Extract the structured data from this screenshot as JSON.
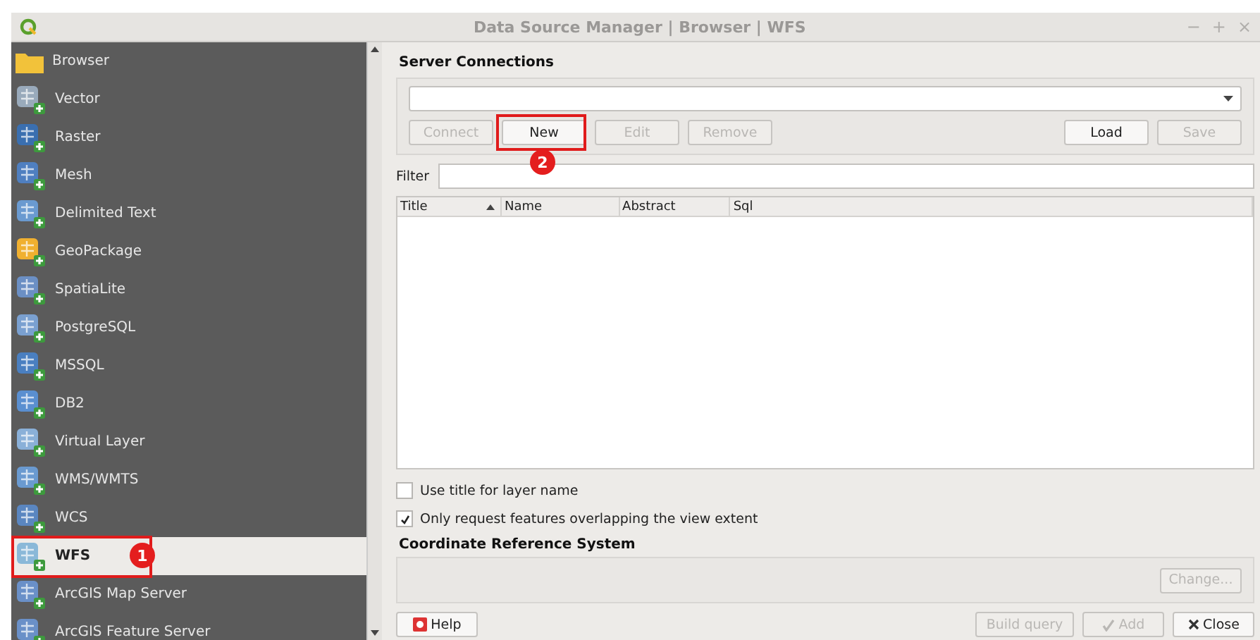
{
  "window": {
    "title": "Data Source Manager | Browser | WFS",
    "controls": [
      "−",
      "+",
      "×"
    ]
  },
  "sidebar": {
    "items": [
      {
        "label": "Browser",
        "selected": false
      },
      {
        "label": "Vector",
        "selected": false
      },
      {
        "label": "Raster",
        "selected": false
      },
      {
        "label": "Mesh",
        "selected": false
      },
      {
        "label": "Delimited Text",
        "selected": false
      },
      {
        "label": "GeoPackage",
        "selected": false
      },
      {
        "label": "SpatiaLite",
        "selected": false
      },
      {
        "label": "PostgreSQL",
        "selected": false
      },
      {
        "label": "MSSQL",
        "selected": false
      },
      {
        "label": "DB2",
        "selected": false
      },
      {
        "label": "Virtual Layer",
        "selected": false
      },
      {
        "label": "WMS/WMTS",
        "selected": false
      },
      {
        "label": "WCS",
        "selected": false
      },
      {
        "label": "WFS",
        "selected": true,
        "annotation": "1"
      },
      {
        "label": "ArcGIS Map Server",
        "selected": false
      },
      {
        "label": "ArcGIS Feature Server",
        "selected": false
      }
    ]
  },
  "server_connections": {
    "title": "Server Connections",
    "buttons": [
      {
        "label": "Connect",
        "disabled": true
      },
      {
        "label": "New",
        "disabled": false,
        "annotation": "2"
      },
      {
        "label": "Edit",
        "disabled": true
      },
      {
        "label": "Remove",
        "disabled": true
      }
    ],
    "right_buttons": [
      {
        "label": "Load",
        "disabled": false
      },
      {
        "label": "Save",
        "disabled": true
      }
    ]
  },
  "filter": {
    "label": "Filter"
  },
  "table": {
    "columns": [
      {
        "label": "Title",
        "sorted": true
      },
      {
        "label": "Name",
        "sorted": false
      },
      {
        "label": "Abstract",
        "sorted": false
      },
      {
        "label": "Sql",
        "sorted": false
      }
    ]
  },
  "options": [
    {
      "label": "Use title for layer name",
      "checked": false
    },
    {
      "label": "Only request features overlapping the view extent",
      "checked": true
    }
  ],
  "crs": {
    "title": "Coordinate Reference System",
    "button": {
      "label": "Change...",
      "disabled": true
    }
  },
  "footer": {
    "help": "Help",
    "buttons": [
      {
        "label": "Build query",
        "disabled": true
      },
      {
        "label": "Add",
        "disabled": true
      },
      {
        "label": "Close",
        "disabled": false
      }
    ]
  }
}
